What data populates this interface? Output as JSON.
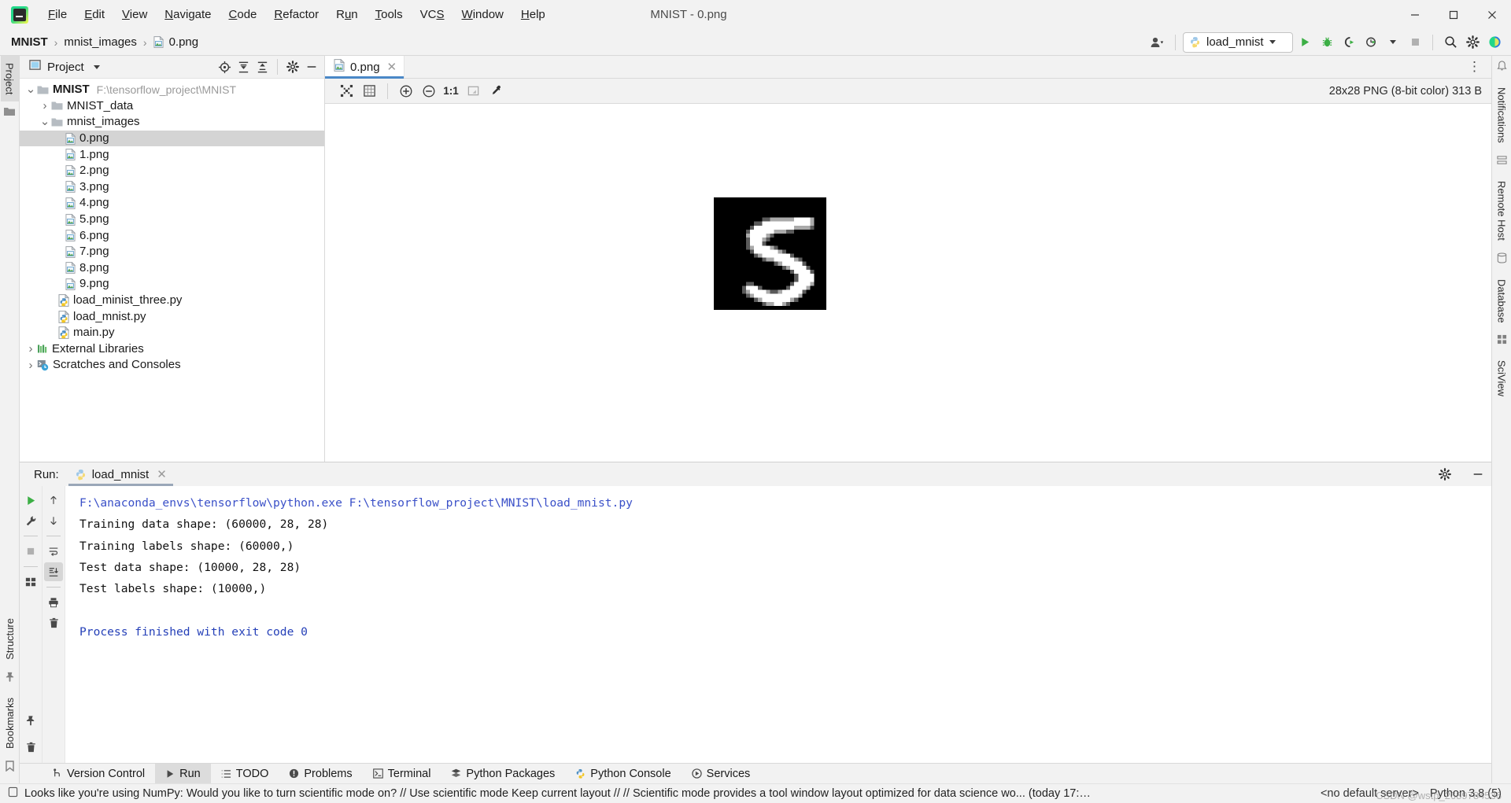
{
  "window": {
    "title": "MNIST - 0.png",
    "logo_icon": "pycharm-logo-icon",
    "minimize_icon": "minimize-icon",
    "maximize_icon": "maximize-icon",
    "close_icon": "close-icon"
  },
  "menubar": [
    {
      "label": "File",
      "mnemonic": "F"
    },
    {
      "label": "Edit",
      "mnemonic": "E"
    },
    {
      "label": "View",
      "mnemonic": "V"
    },
    {
      "label": "Navigate",
      "mnemonic": "N"
    },
    {
      "label": "Code",
      "mnemonic": "C"
    },
    {
      "label": "Refactor",
      "mnemonic": "R"
    },
    {
      "label": "Run",
      "mnemonic": "u"
    },
    {
      "label": "Tools",
      "mnemonic": "T"
    },
    {
      "label": "VCS",
      "mnemonic": "S"
    },
    {
      "label": "Window",
      "mnemonic": "W"
    },
    {
      "label": "Help",
      "mnemonic": "H"
    }
  ],
  "breadcrumb": {
    "items": [
      "MNIST",
      "mnist_images",
      "0.png"
    ],
    "separator": "›"
  },
  "navbar_right": {
    "account_icon": "user-account-icon",
    "run_config": {
      "label": "load_mnist",
      "icon": "python-file-icon"
    },
    "run_icon": "run-icon",
    "debug_icon": "debug-icon",
    "coverage_icon": "run-with-coverage-icon",
    "profile_icon": "profile-icon",
    "stop_icon": "stop-icon",
    "search_icon": "search-everywhere-icon",
    "settings_icon": "settings-gear-icon",
    "updates_icon": "ide-updates-icon"
  },
  "left_rail": {
    "tabs": [
      "Project"
    ],
    "bookmark_label": "Bookmarks",
    "structure_label": "Structure"
  },
  "right_rail": {
    "tabs": [
      "Notifications",
      "Remote Host",
      "Database",
      "SciView"
    ]
  },
  "project_panel": {
    "title": "Project",
    "icon": "project-window-icon",
    "dropdown_icon": "chevron-down-icon",
    "locate_icon": "select-opened-file-icon",
    "expand_icon": "expand-all-icon",
    "collapse_icon": "collapse-all-icon",
    "settings_icon": "gear-icon",
    "hide_icon": "hide-panel-icon",
    "tree": [
      {
        "label": "MNIST",
        "path": "F:\\tensorflow_project\\MNIST",
        "icon": "folder-icon",
        "indent": 0,
        "expanded": true,
        "bold": true
      },
      {
        "label": "MNIST_data",
        "icon": "folder-icon",
        "indent": 1,
        "expanded": false
      },
      {
        "label": "mnist_images",
        "icon": "folder-icon",
        "indent": 1,
        "expanded": true
      },
      {
        "label": "0.png",
        "icon": "image-file-icon",
        "indent": 2,
        "selected": true
      },
      {
        "label": "1.png",
        "icon": "image-file-icon",
        "indent": 2
      },
      {
        "label": "2.png",
        "icon": "image-file-icon",
        "indent": 2
      },
      {
        "label": "3.png",
        "icon": "image-file-icon",
        "indent": 2
      },
      {
        "label": "4.png",
        "icon": "image-file-icon",
        "indent": 2
      },
      {
        "label": "5.png",
        "icon": "image-file-icon",
        "indent": 2
      },
      {
        "label": "6.png",
        "icon": "image-file-icon",
        "indent": 2
      },
      {
        "label": "7.png",
        "icon": "image-file-icon",
        "indent": 2
      },
      {
        "label": "8.png",
        "icon": "image-file-icon",
        "indent": 2
      },
      {
        "label": "9.png",
        "icon": "image-file-icon",
        "indent": 2
      },
      {
        "label": "load_minist_three.py",
        "icon": "python-file-icon",
        "indent": 1.5
      },
      {
        "label": "load_mnist.py",
        "icon": "python-file-icon",
        "indent": 1.5
      },
      {
        "label": "main.py",
        "icon": "python-file-icon",
        "indent": 1.5
      },
      {
        "label": "External Libraries",
        "icon": "library-icon",
        "indent": 0,
        "expanded": false
      },
      {
        "label": "Scratches and Consoles",
        "icon": "scratches-icon",
        "indent": 0,
        "expanded": false
      }
    ]
  },
  "editor": {
    "tabs": [
      {
        "label": "0.png",
        "icon": "image-file-icon",
        "active": true,
        "close_icon": "close-icon"
      }
    ],
    "more_icon": "more-options-icon",
    "toolbar": {
      "fit_icon": "fit-content-icon",
      "grid_icon": "toggle-grid-icon",
      "zoom_in_icon": "zoom-in-icon",
      "zoom_out_icon": "zoom-out-icon",
      "actual_size_label": "1:1",
      "transparency_icon": "toggle-transparency-chessboard-icon",
      "color_picker_icon": "color-picker-icon"
    },
    "image_info": "28x28 PNG (8-bit color) 313 B",
    "image_alt": "mnist-digit-5-preview"
  },
  "run_panel": {
    "label": "Run:",
    "tab": {
      "label": "load_mnist",
      "icon": "python-file-icon",
      "close_icon": "close-icon"
    },
    "settings_icon": "gear-icon",
    "hide_icon": "hide-panel-icon",
    "gutter": {
      "rerun_icon": "rerun-icon",
      "settings_icon": "wrench-icon",
      "stop_icon": "stop-icon",
      "layout_icon": "layout-icon",
      "pin_icon": "pin-tab-icon",
      "up_icon": "scroll-up-icon",
      "down_icon": "scroll-down-icon",
      "soft_wrap_icon": "soft-wrap-icon",
      "scroll_end_icon": "scroll-to-end-icon",
      "print_icon": "print-icon",
      "clear_icon": "clear-all-icon"
    },
    "console_lines": [
      {
        "text": "F:\\anaconda_envs\\tensorflow\\python.exe F:\\tensorflow_project\\MNIST\\load_mnist.py",
        "style": "cmd"
      },
      {
        "text": "Training data shape: (60000, 28, 28)",
        "style": "out"
      },
      {
        "text": "Training labels shape: (60000,)",
        "style": "out"
      },
      {
        "text": "Test data shape: (10000, 28, 28)",
        "style": "out"
      },
      {
        "text": "Test labels shape: (10000,)",
        "style": "out"
      },
      {
        "text": "",
        "style": "out"
      },
      {
        "text": "Process finished with exit code 0",
        "style": "fin"
      }
    ]
  },
  "bottom_tabs": [
    {
      "label": "Version Control",
      "icon": "branch-icon",
      "active": false
    },
    {
      "label": "Run",
      "icon": "run-icon",
      "active": true
    },
    {
      "label": "TODO",
      "icon": "todo-icon",
      "active": false
    },
    {
      "label": "Problems",
      "icon": "problems-icon",
      "active": false
    },
    {
      "label": "Terminal",
      "icon": "terminal-icon",
      "active": false
    },
    {
      "label": "Python Packages",
      "icon": "packages-icon",
      "active": false
    },
    {
      "label": "Python Console",
      "icon": "python-console-icon",
      "active": false
    },
    {
      "label": "Services",
      "icon": "services-icon",
      "active": false
    }
  ],
  "statusbar": {
    "event_icon": "event-log-icon",
    "message": "Looks like you're using NumPy: Would you like to turn scientific mode on? // Use scientific mode   Keep current layout // // Scientific mode provides a tool window layout optimized for data science wo... (today 17:…",
    "server": "<no default server>",
    "interpreter": "Python 3.8 (5)",
    "watermark": "CSDN @wstp_2689784536"
  },
  "colors": {
    "accent_blue": "#4a88c7",
    "panel_bg": "#f2f2f2",
    "editor_bg": "#ffffff",
    "selection": "#d4d4d4",
    "console_cmd": "#3a50c8",
    "console_finish": "#2540b8",
    "run_green": "#3caf45"
  },
  "mnist_pixels": [
    "0000000000000000000000000000",
    "0000000000000000000000000000",
    "0000000000000000000000000000",
    "0000000000000000000000000000",
    "0000000000000000000000000000",
    "0000000000001122222233332000",
    "0000000000113333333333332000",
    "0000000001333333333322221000",
    "0000000013333332221100000000",
    "0000000023333210000000000000",
    "0000000013332100000000000000",
    "0000000013331000000000000000",
    "0000000012333321000000000000",
    "0000000001333333210000000000",
    "0000000000123333333100000000",
    "0000000000001223333321000000",
    "0000000000000001233333100000",
    "0000000000000000012333310000",
    "0000000000000000000133331000",
    "0000000000000000000013333000",
    "0000000000000000000013333000",
    "0000000011000000000133332000",
    "0000000133310000001333320000",
    "0000000123333211233333100000",
    "0000000012333333333332000000",
    "0000000000123333333210000000",
    "0000000000001223321000000000",
    "0000000000000000000000000000"
  ]
}
